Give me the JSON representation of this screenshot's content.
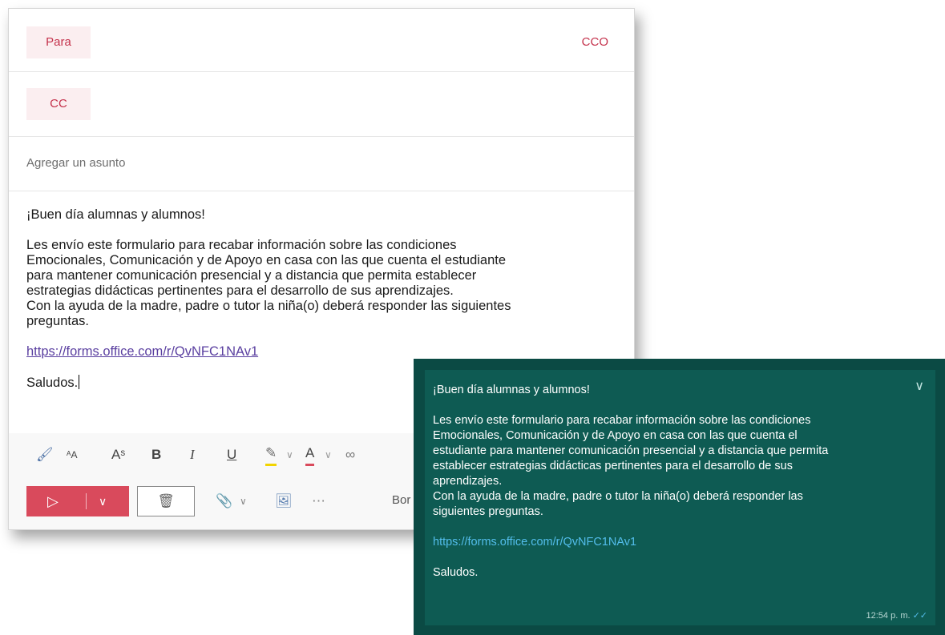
{
  "email": {
    "to_label": "Para",
    "cco_label": "CCO",
    "cc_label": "CC",
    "subject_placeholder": "Agregar un asunto",
    "body": {
      "greeting": "¡Buen día alumnas y alumnos!",
      "lines": [
        "Les envío este formulario para recabar información sobre las condiciones",
        "Emocionales, Comunicación y de Apoyo en casa con las que cuenta el estudiante",
        "para mantener comunicación presencial y a distancia que permita establecer",
        "estrategias didácticas pertinentes para el desarrollo de sus aprendizajes.",
        "Con la ayuda de la madre, padre o tutor la niña(o) deberá responder las siguientes",
        "preguntas."
      ],
      "link": "https://forms.office.com/r/QvNFC1NAv1",
      "closing": "Saludos."
    },
    "format_icons": [
      "format-painter-icon",
      "font-size-decrease-icon",
      "font-size-increase-icon",
      "bold-icon",
      "italic-icon",
      "underline-icon",
      "highlight-icon",
      "font-color-icon",
      "link-icon"
    ],
    "discard_partial_label": "Bor"
  },
  "whatsapp": {
    "greeting": "¡Buen día alumnas y alumnos!",
    "lines": [
      "Les envío este formulario para recabar información sobre las condiciones",
      "Emocionales, Comunicación y de Apoyo en casa con las que cuenta el",
      "estudiante para mantener comunicación presencial y a distancia que permita",
      "establecer estrategias didácticas pertinentes para el desarrollo de sus",
      "aprendizajes.",
      "Con la ayuda de la madre, padre o tutor la niña(o) deberá responder las",
      "siguientes preguntas."
    ],
    "link": "https://forms.office.com/r/QvNFC1NAv1",
    "closing": "Saludos.",
    "time": "12:54 p. m."
  },
  "colors": {
    "accent": "#c4314b",
    "send_button": "#d94a5c",
    "whatsapp_bubble": "#0e5b53",
    "link": "#5a3fa0"
  }
}
